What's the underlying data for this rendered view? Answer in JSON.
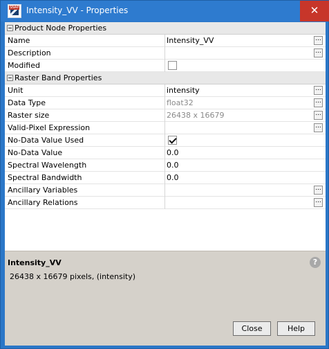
{
  "window": {
    "title": "Intensity_VV - Properties",
    "close_glyph": "✕",
    "app_icon_tag": "SNAP"
  },
  "sections": {
    "product": {
      "label": "Product Node Properties"
    },
    "raster": {
      "label": "Raster Band Properties"
    }
  },
  "rows": {
    "name": {
      "label": "Name",
      "value": "Intensity_VV"
    },
    "description": {
      "label": "Description",
      "value": ""
    },
    "modified": {
      "label": "Modified",
      "checked": false
    },
    "unit": {
      "label": "Unit",
      "value": "intensity"
    },
    "data_type": {
      "label": "Data Type",
      "value": "float32"
    },
    "raster_size": {
      "label": "Raster size",
      "value": "26438 x 16679"
    },
    "valid_pixel": {
      "label": "Valid-Pixel Expression",
      "value": ""
    },
    "no_data_used": {
      "label": "No-Data Value Used",
      "checked": true
    },
    "no_data_value": {
      "label": "No-Data Value",
      "value": "0.0"
    },
    "spectral_wavelength": {
      "label": "Spectral Wavelength",
      "value": "0.0"
    },
    "spectral_bandwidth": {
      "label": "Spectral Bandwidth",
      "value": "0.0"
    },
    "ancillary_variables": {
      "label": "Ancillary Variables",
      "value": ""
    },
    "ancillary_relations": {
      "label": "Ancillary Relations",
      "value": ""
    }
  },
  "ellipsis_label": "...",
  "description_panel": {
    "title": "Intensity_VV",
    "text": "26438 x 16679 pixels, (intensity)",
    "help_glyph": "?"
  },
  "buttons": {
    "close": "Close",
    "help": "Help"
  },
  "colors": {
    "titlebar": "#2e7bcf",
    "close_button": "#c7362a",
    "description_panel": "#d5d1ca"
  }
}
